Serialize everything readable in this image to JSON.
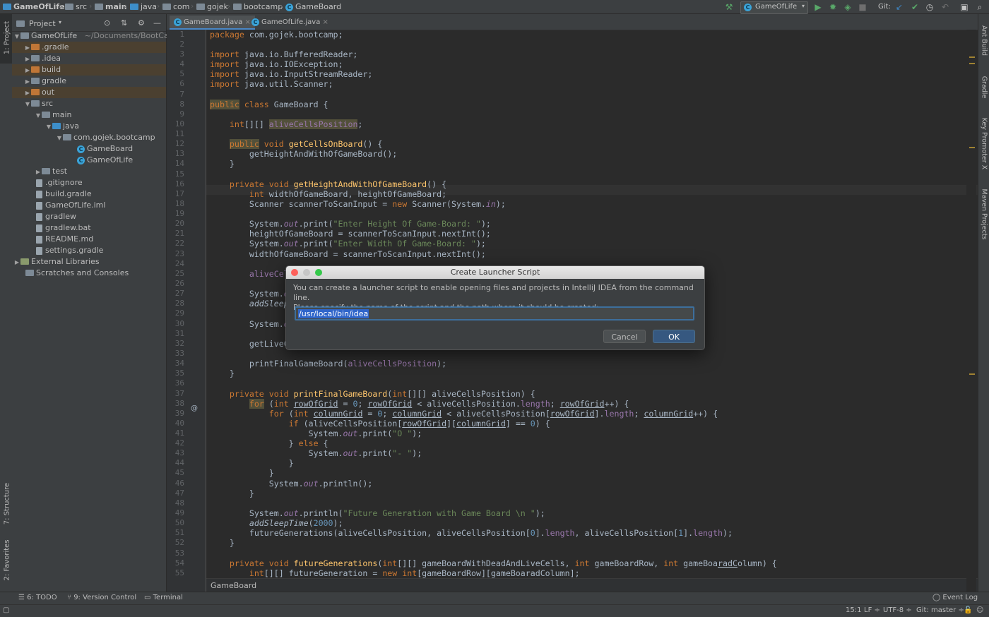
{
  "navbar": {
    "crumbs": [
      "GameOfLife",
      "src",
      "main",
      "java",
      "com",
      "gojek",
      "bootcamp",
      "GameBoard"
    ],
    "run_config": "GameOfLife",
    "git_label": "Git:"
  },
  "left_strip": {
    "project_tab": "1: Project",
    "structure_tab": "7: Structure",
    "favorites_tab": "2: Favorites"
  },
  "project": {
    "header": "Project",
    "root_name": "GameOfLife",
    "root_path": "~/Documents/BootCamp",
    "items": [
      ".gradle",
      ".idea",
      "build",
      "gradle",
      "out",
      "src",
      "main",
      "java",
      "com.gojek.bootcamp",
      "GameBoard",
      "GameOfLife",
      "test",
      ".gitignore",
      "build.gradle",
      "GameOfLife.iml",
      "gradlew",
      "gradlew.bat",
      "README.md",
      "settings.gradle",
      "External Libraries",
      "Scratches and Consoles"
    ]
  },
  "tabs": [
    "GameBoard.java",
    "GameOfLife.java"
  ],
  "tab_close": "×",
  "editor": {
    "line_numbers": [
      "1",
      "2",
      "3",
      "4",
      "5",
      "6",
      "7",
      "8",
      "9",
      "10",
      "11",
      "12",
      "13",
      "14",
      "15",
      "16",
      "17",
      "18",
      "19",
      "20",
      "21",
      "22",
      "23",
      "24",
      "25",
      "26",
      "27",
      "28",
      "29",
      "30",
      "31",
      "32",
      "33",
      "34",
      "35",
      "36",
      "37",
      "38",
      "39",
      "40",
      "41",
      "42",
      "43",
      "44",
      "45",
      "46",
      "47",
      "48",
      "49",
      "50",
      "51",
      "52",
      "53",
      "54",
      "55"
    ],
    "gutter_at": "@",
    "breadcrumb": "GameBoard"
  },
  "right_strip": {
    "tabs": [
      "Ant Build",
      "Gradle",
      "Key Promoter X",
      "Maven Projects"
    ]
  },
  "bottom_tools": {
    "todo": "6: TODO",
    "vcs": "9: Version Control",
    "terminal": "Terminal",
    "event_log": "Event Log"
  },
  "status": {
    "position": "15:1",
    "line_sep": "LF ÷",
    "encoding": "UTF-8 ÷",
    "git": "Git: master ÷"
  },
  "dialog": {
    "title": "Create Launcher Script",
    "message_line1": "You can create a launcher script to enable opening files and projects in IntelliJ IDEA from the command line.",
    "message_line2": "Please specify the name of the script and the path where it should be created:",
    "path_value": "/usr/local/bin/idea",
    "cancel_label": "Cancel",
    "ok_label": "OK"
  },
  "colors": {
    "background": "#2b2b2b",
    "panel": "#3c3f41",
    "keyword": "#cc7832",
    "function": "#ffc66d",
    "string": "#6a8759",
    "accent": "#365880"
  }
}
